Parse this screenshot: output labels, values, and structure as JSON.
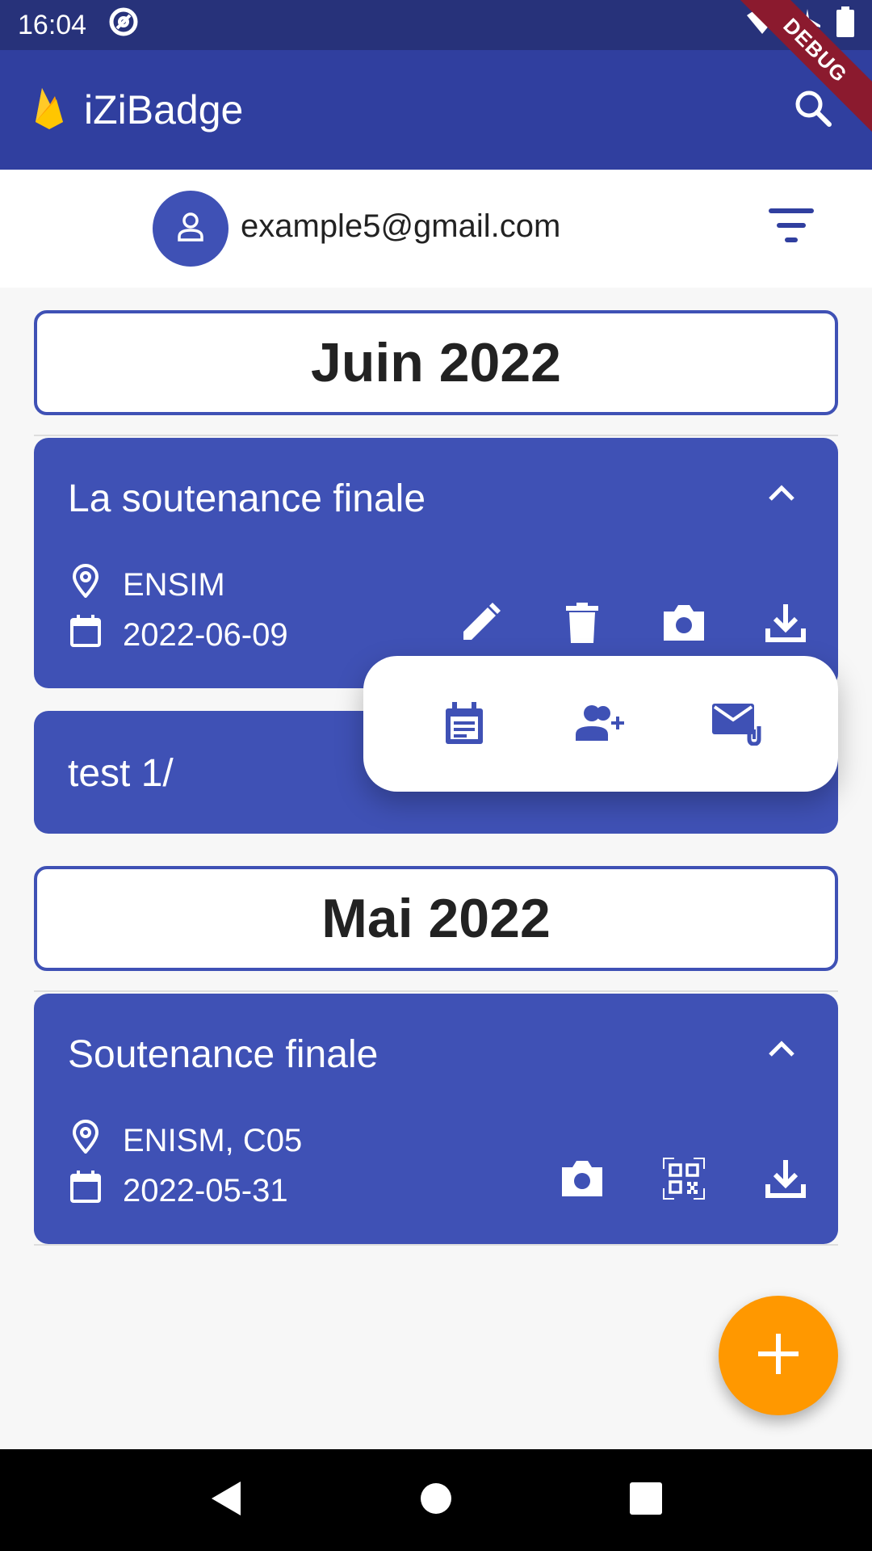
{
  "status_bar": {
    "time": "16:04",
    "icons": [
      "at-sign-icon",
      "wifi-icon",
      "airplane-icon",
      "battery-icon"
    ]
  },
  "app_bar": {
    "title": "iZiBadge",
    "logo": "firebase-flame-icon",
    "search_icon": "search-icon",
    "debug_label": "DEBUG"
  },
  "user": {
    "email": "example5@gmail.com",
    "avatar_icon": "person-icon",
    "filter_icon": "filter-icon"
  },
  "months": [
    {
      "label": "Juin 2022",
      "events": [
        {
          "title": "La soutenance finale",
          "location": "ENSIM",
          "date": "2022-06-09",
          "actions": [
            "edit-icon",
            "delete-icon",
            "camera-icon",
            "download-icon"
          ],
          "expanded": true
        },
        {
          "title": "test 1/"
        }
      ]
    },
    {
      "label": "Mai 2022",
      "events": [
        {
          "title": "Soutenance finale",
          "location": "ENISM, C05",
          "date": "2022-05-31",
          "actions": [
            "camera-icon",
            "qr-code-icon",
            "download-icon"
          ],
          "expanded": true
        }
      ]
    }
  ],
  "popup_menu": {
    "items": [
      "calendar-notes-icon",
      "add-person-icon",
      "email-attachment-icon"
    ]
  },
  "fab": {
    "icon": "plus-icon"
  },
  "colors": {
    "primary": "#303f9f",
    "card": "#3f51b5",
    "accent": "#ff9800",
    "status_bar": "#27327a"
  }
}
